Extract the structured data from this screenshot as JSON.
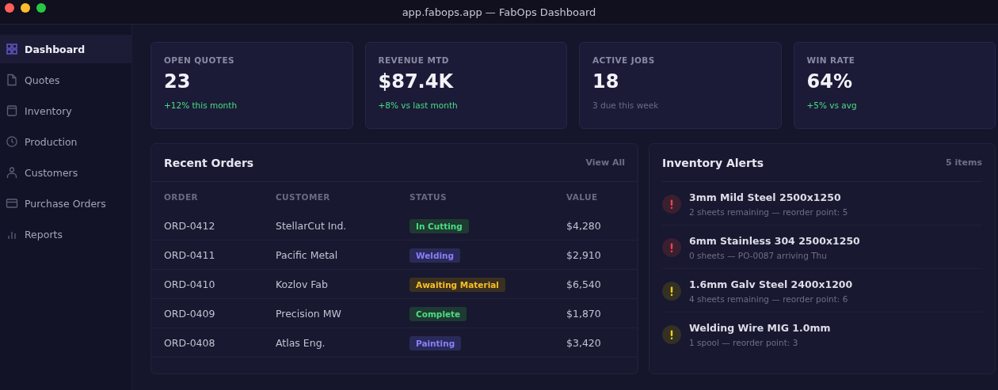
{
  "window": {
    "title": "app.fabops.app — FabOps Dashboard"
  },
  "sidebar": {
    "items": [
      {
        "label": "Dashboard",
        "selected": true
      },
      {
        "label": "Quotes",
        "selected": false
      },
      {
        "label": "Inventory",
        "selected": false
      },
      {
        "label": "Production",
        "selected": false
      },
      {
        "label": "Customers",
        "selected": false
      },
      {
        "label": "Purchase Orders",
        "selected": false
      },
      {
        "label": "Reports",
        "selected": false
      }
    ]
  },
  "stats": [
    {
      "label": "OPEN QUOTES",
      "value": "23",
      "note": "+12% this month",
      "kind": "up"
    },
    {
      "label": "REVENUE MTD",
      "value": "$87.4K",
      "note": "+8% vs last month",
      "kind": "up"
    },
    {
      "label": "ACTIVE JOBS",
      "value": "18",
      "note": "3 due this week",
      "kind": "neutral"
    },
    {
      "label": "WIN RATE",
      "value": "64%",
      "note": "+5% vs avg",
      "kind": "up"
    }
  ],
  "recent_orders": {
    "title": "Recent Orders",
    "link": "View All",
    "columns": [
      "ORDER",
      "CUSTOMER",
      "STATUS",
      "VALUE"
    ],
    "rows": [
      {
        "order": "ORD-0412",
        "customer": "StellarCut Ind.",
        "status": "In Cutting",
        "kind": "green",
        "value": "$4,280"
      },
      {
        "order": "ORD-0411",
        "customer": "Pacific Metal",
        "status": "Welding",
        "kind": "purple",
        "value": "$2,910"
      },
      {
        "order": "ORD-0410",
        "customer": "Kozlov Fab",
        "status": "Awaiting Material",
        "kind": "amber",
        "value": "$6,540"
      },
      {
        "order": "ORD-0409",
        "customer": "Precision MW",
        "status": "Complete",
        "kind": "green",
        "value": "$1,870"
      },
      {
        "order": "ORD-0408",
        "customer": "Atlas Eng.",
        "status": "Painting",
        "kind": "purple",
        "value": "$3,420"
      }
    ]
  },
  "inventory_alerts": {
    "title": "Inventory Alerts",
    "count": "5 items",
    "items": [
      {
        "name": "3mm Mild Steel 2500x1250",
        "detail": "2 sheets remaining — reorder point: 5",
        "kind": "critical"
      },
      {
        "name": "6mm Stainless 304 2500x1250",
        "detail": "0 sheets — PO-0087 arriving Thu",
        "kind": "critical"
      },
      {
        "name": "1.6mm Galv Steel 2400x1200",
        "detail": "4 sheets remaining — reorder point: 6",
        "kind": "warning"
      },
      {
        "name": "Welding Wire MIG 1.0mm",
        "detail": "1 spool — reorder point: 3",
        "kind": "warning"
      }
    ]
  }
}
